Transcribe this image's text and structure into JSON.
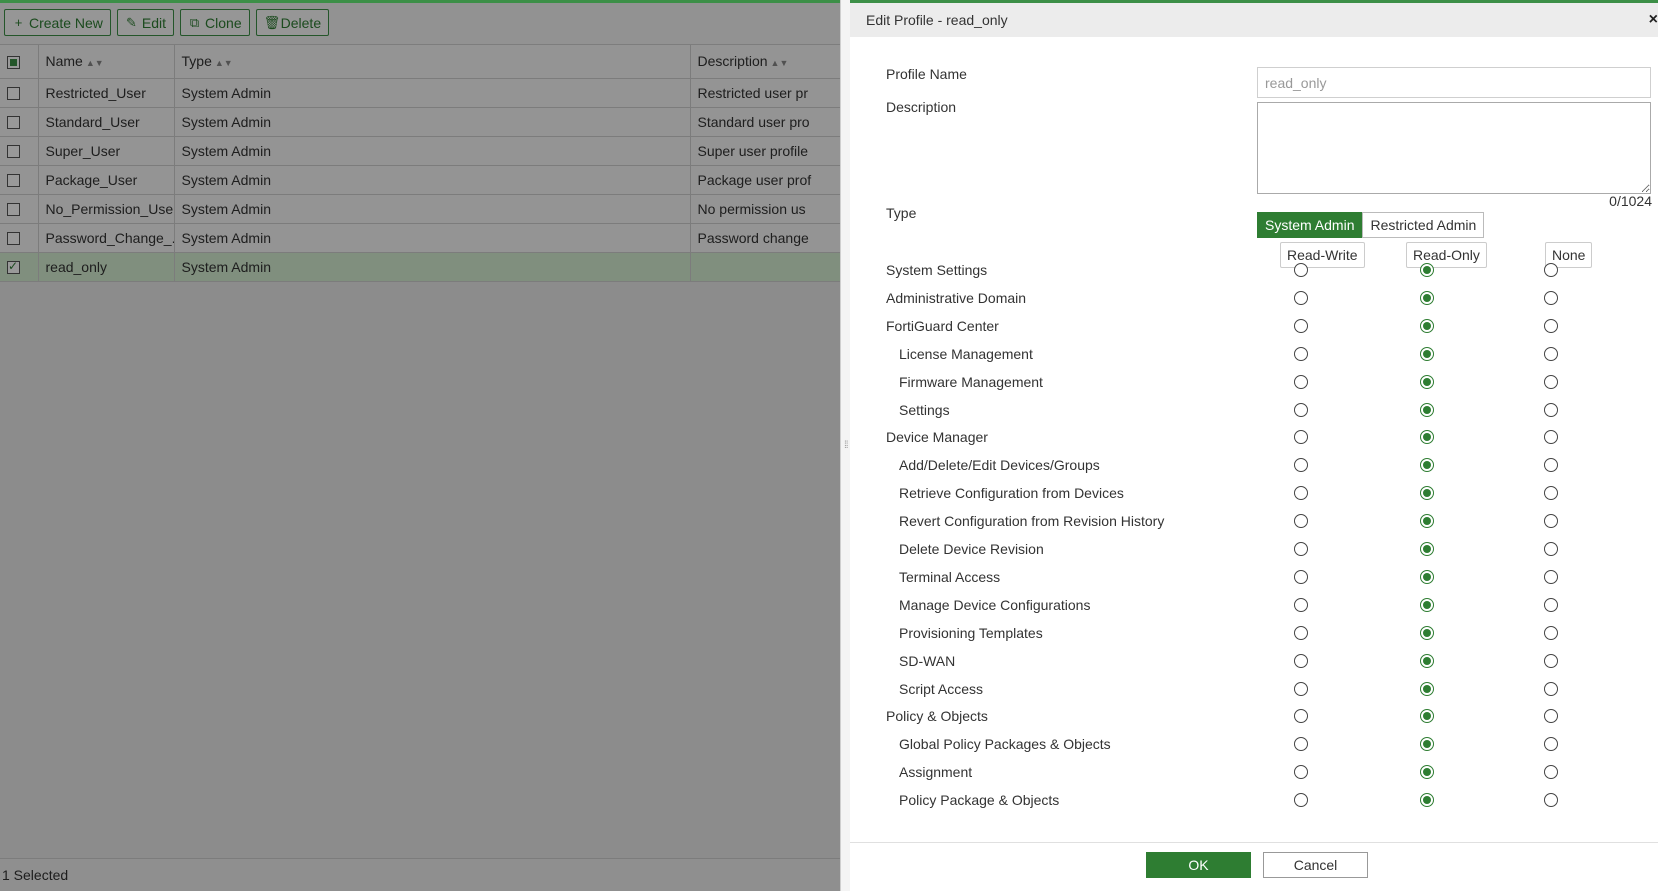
{
  "toolbar": {
    "create_label": "Create New",
    "edit_label": "Edit",
    "clone_label": "Clone",
    "delete_label": "Delete"
  },
  "grid": {
    "columns": [
      "Name",
      "Type",
      "Description"
    ],
    "rows": [
      {
        "name": "Restricted_User",
        "type": "System Admin",
        "description": "Restricted user pr"
      },
      {
        "name": "Standard_User",
        "type": "System Admin",
        "description": "Standard user pro"
      },
      {
        "name": "Super_User",
        "type": "System Admin",
        "description": "Super user profile"
      },
      {
        "name": "Package_User",
        "type": "System Admin",
        "description": "Package user prof"
      },
      {
        "name": "No_Permission_User",
        "type": "System Admin",
        "description": "No permission us"
      },
      {
        "name": "Password_Change_...",
        "type": "System Admin",
        "description": "Password change"
      },
      {
        "name": "read_only",
        "type": "System Admin",
        "description": ""
      }
    ],
    "selected_row": 6
  },
  "status": {
    "selected_text": "1 Selected"
  },
  "panel": {
    "title": "Edit Profile - read_only",
    "close_glyph": "×",
    "profile_name_label": "Profile Name",
    "profile_name_value": "read_only",
    "description_label": "Description",
    "char_count": "0/1024",
    "type_label": "Type",
    "type_options": [
      "System Admin",
      "Restricted Admin"
    ],
    "type_selected": "System Admin",
    "perm_columns": [
      "Read-Write",
      "Read-Only",
      "None"
    ],
    "permissions": [
      {
        "label": "System Settings",
        "level": 0,
        "value": "Read-Only"
      },
      {
        "label": "Administrative Domain",
        "level": 0,
        "value": "Read-Only"
      },
      {
        "label": "FortiGuard Center",
        "level": 0,
        "value": "Read-Only"
      },
      {
        "label": "License Management",
        "level": 1,
        "value": "Read-Only"
      },
      {
        "label": "Firmware Management",
        "level": 1,
        "value": "Read-Only"
      },
      {
        "label": "Settings",
        "level": 1,
        "value": "Read-Only"
      },
      {
        "label": "Device Manager",
        "level": 0,
        "value": "Read-Only"
      },
      {
        "label": "Add/Delete/Edit Devices/Groups",
        "level": 1,
        "value": "Read-Only"
      },
      {
        "label": "Retrieve Configuration from Devices",
        "level": 1,
        "value": "Read-Only"
      },
      {
        "label": "Revert Configuration from Revision History",
        "level": 1,
        "value": "Read-Only"
      },
      {
        "label": "Delete Device Revision",
        "level": 1,
        "value": "Read-Only"
      },
      {
        "label": "Terminal Access",
        "level": 1,
        "value": "Read-Only"
      },
      {
        "label": "Manage Device Configurations",
        "level": 1,
        "value": "Read-Only"
      },
      {
        "label": "Provisioning Templates",
        "level": 1,
        "value": "Read-Only"
      },
      {
        "label": "SD-WAN",
        "level": 1,
        "value": "Read-Only"
      },
      {
        "label": "Script Access",
        "level": 1,
        "value": "Read-Only"
      },
      {
        "label": "Policy & Objects",
        "level": 0,
        "value": "Read-Only"
      },
      {
        "label": "Global Policy Packages & Objects",
        "level": 1,
        "value": "Read-Only"
      },
      {
        "label": "Assignment",
        "level": 1,
        "value": "Read-Only"
      },
      {
        "label": "Policy Package & Objects",
        "level": 1,
        "value": "Read-Only"
      }
    ],
    "ok_label": "OK",
    "cancel_label": "Cancel"
  },
  "colors": {
    "accent": "#2e7d32",
    "selected_row": "#d5efd2"
  }
}
